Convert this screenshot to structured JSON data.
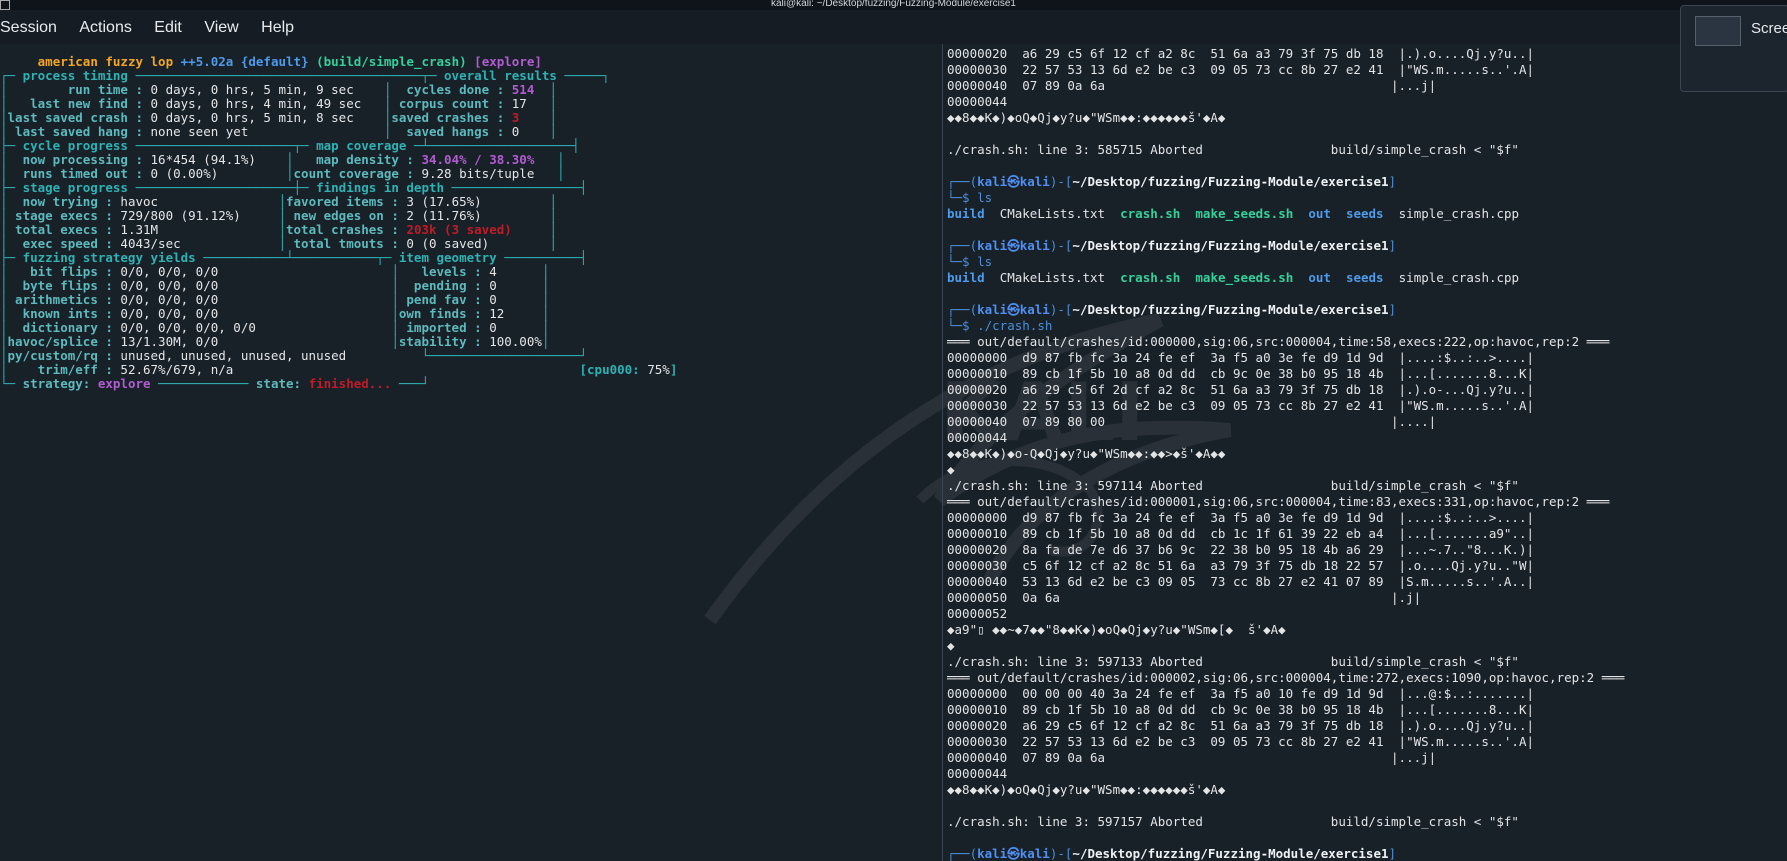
{
  "window": {
    "title": "kali@kali: ~/Desktop/fuzzing/Fuzzing-Module/exercise1"
  },
  "menu": [
    "Session",
    "Actions",
    "Edit",
    "View",
    "Help"
  ],
  "notification": {
    "label": "Scree"
  },
  "afl": {
    "banner": {
      "name": "american fuzzy lop ",
      "version": "++5.02a",
      "instance": " {default} ",
      "target": "(build/simple_crash) ",
      "mode": "[explore]"
    },
    "sections": {
      "process_timing": "process timing",
      "overall_results": "overall results",
      "cycle_progress": "cycle progress",
      "map_coverage": "map coverage",
      "stage_progress": "stage progress",
      "findings": "findings in depth",
      "strategy_yields": "fuzzing strategy yields",
      "item_geometry": "item geometry"
    },
    "process_timing": [
      {
        "label": "        run time :",
        "value": " 0 days, 0 hrs, 5 min, 9 sec"
      },
      {
        "label": "   last new find :",
        "value": " 0 days, 0 hrs, 4 min, 49 sec"
      },
      {
        "label": "last saved crash :",
        "value": " 0 days, 0 hrs, 5 min, 8 sec"
      },
      {
        "label": " last saved hang :",
        "value": " none seen yet"
      }
    ],
    "overall_results": [
      {
        "label": "  cycles done :",
        "value": " 514",
        "cls": "c-mag"
      },
      {
        "label": " corpus count :",
        "value": " 17",
        "cls": "c-val"
      },
      {
        "label": "saved crashes :",
        "value": " 3",
        "cls": "c-warn"
      },
      {
        "label": "  saved hangs :",
        "value": " 0",
        "cls": "c-val"
      }
    ],
    "cycle_progress": [
      {
        "label": "  now processing :",
        "value": " 16*454 (94.1%)"
      },
      {
        "label": "  runs timed out :",
        "value": " 0 (0.00%)"
      }
    ],
    "map_coverage": [
      {
        "label": "   map density :",
        "value": " 34.04% / 38.30%",
        "cls": "c-mag"
      },
      {
        "label": "count coverage :",
        "value": " 9.28 bits/tuple",
        "cls": "c-val"
      }
    ],
    "stage_progress": [
      {
        "label": "  now trying :",
        "value": " havoc"
      },
      {
        "label": " stage execs :",
        "value": " 729/800 (91.12%)"
      },
      {
        "label": " total execs :",
        "value": " 1.31M"
      },
      {
        "label": "  exec speed :",
        "value": " 4043/sec"
      }
    ],
    "findings": [
      {
        "label": "favored items :",
        "value": " 3 (17.65%)",
        "cls": "c-val"
      },
      {
        "label": " new edges on :",
        "value": " 2 (11.76%)",
        "cls": "c-val"
      },
      {
        "label": "total crashes :",
        "value": " 203k (3 saved)",
        "cls": "c-warn"
      },
      {
        "label": " total tmouts :",
        "value": " 0 (0 saved)",
        "cls": "c-val"
      }
    ],
    "yields": [
      {
        "label": "   bit flips :",
        "value": " 0/0, 0/0, 0/0"
      },
      {
        "label": "  byte flips :",
        "value": " 0/0, 0/0, 0/0"
      },
      {
        "label": " arithmetics :",
        "value": " 0/0, 0/0, 0/0"
      },
      {
        "label": "  known ints :",
        "value": " 0/0, 0/0, 0/0"
      },
      {
        "label": "  dictionary :",
        "value": " 0/0, 0/0, 0/0, 0/0"
      },
      {
        "label": "havoc/splice :",
        "value": " 13/1.30M, 0/0"
      },
      {
        "label": "py/custom/rq :",
        "value": " unused, unused, unused, unused"
      },
      {
        "label": "    trim/eff :",
        "value": " 52.67%/679, n/a"
      }
    ],
    "geometry": [
      {
        "label": "   levels :",
        "value": " 4"
      },
      {
        "label": "  pending :",
        "value": " 0"
      },
      {
        "label": " pend fav :",
        "value": " 0"
      },
      {
        "label": "own finds :",
        "value": " 12"
      },
      {
        "label": " imported :",
        "value": " 0"
      },
      {
        "label": "stability :",
        "value": " 100.00%"
      }
    ],
    "cpu": {
      "label": "[cpu000: ",
      "value": "75%",
      "close": "]"
    },
    "strategy": {
      "label": "strategy: ",
      "value": "explore"
    },
    "state": {
      "label": "state: ",
      "value": "finished..."
    }
  },
  "terminal": {
    "prompt": {
      "user": "kali",
      "at": "㉿",
      "host": "kali",
      "path": "~/Desktop/fuzzing/Fuzzing-Module/exercise1"
    },
    "lines": [
      {
        "t": "text",
        "v": "00000020  a6 29 c5 6f 12 cf a2 8c  51 6a a3 79 3f 75 db 18  |.).o....Qj.y?u..|"
      },
      {
        "t": "text",
        "v": "00000030  22 57 53 13 6d e2 be c3  09 05 73 cc 8b 27 e2 41  |\"WS.m.....s..'.A|"
      },
      {
        "t": "text",
        "v": "00000040  07 89 0a 6a                                      |...j|"
      },
      {
        "t": "text",
        "v": "00000044"
      },
      {
        "t": "text",
        "v": "◆◆8◆◆K◆)◆oQ◆Qj◆y?u◆\"WSm◆◆:◆◆◆◆◆◆š'◆A◆"
      },
      {
        "t": "text",
        "v": ""
      },
      {
        "t": "text",
        "v": "./crash.sh: line 3: 585715 Aborted                 build/simple_crash < \"$f\""
      },
      {
        "t": "text",
        "v": ""
      },
      {
        "t": "prompt"
      },
      {
        "t": "cmd",
        "v": "ls"
      },
      {
        "t": "ls"
      },
      {
        "t": "text",
        "v": ""
      },
      {
        "t": "prompt"
      },
      {
        "t": "cmd",
        "v": "ls"
      },
      {
        "t": "ls"
      },
      {
        "t": "text",
        "v": ""
      },
      {
        "t": "prompt"
      },
      {
        "t": "cmd",
        "v": "./crash.sh"
      },
      {
        "t": "text",
        "v": "═══ out/default/crashes/id:000000,sig:06,src:000004,time:58,execs:222,op:havoc,rep:2 ═══"
      },
      {
        "t": "text",
        "v": "00000000  d9 87 fb fc 3a 24 fe ef  3a f5 a0 3e fe d9 1d 9d  |....:$..:..>....|"
      },
      {
        "t": "text",
        "v": "00000010  89 cb 1f 5b 10 a8 0d dd  cb 9c 0e 38 b0 95 18 4b  |...[.......8...K|"
      },
      {
        "t": "text",
        "v": "00000020  a6 29 c5 6f 2d cf a2 8c  51 6a a3 79 3f 75 db 18  |.).o-...Qj.y?u..|"
      },
      {
        "t": "text",
        "v": "00000030  22 57 53 13 6d e2 be c3  09 05 73 cc 8b 27 e2 41  |\"WS.m.....s..'.A|"
      },
      {
        "t": "text",
        "v": "00000040  07 89 80 00                                      |....|"
      },
      {
        "t": "text",
        "v": "00000044"
      },
      {
        "t": "text",
        "v": "◆◆8◆◆K◆)◆o-Q◆Qj◆y?u◆\"WSm◆◆:◆◆>◆š'◆A◆◆"
      },
      {
        "t": "text",
        "v": "◆"
      },
      {
        "t": "text",
        "v": "./crash.sh: line 3: 597114 Aborted                 build/simple_crash < \"$f\""
      },
      {
        "t": "text",
        "v": "═══ out/default/crashes/id:000001,sig:06,src:000004,time:83,execs:331,op:havoc,rep:2 ═══"
      },
      {
        "t": "text",
        "v": "00000000  d9 87 fb fc 3a 24 fe ef  3a f5 a0 3e fe d9 1d 9d  |....:$..:..>....|"
      },
      {
        "t": "text",
        "v": "00000010  89 cb 1f 5b 10 a8 0d dd  cb 1c 1f 61 39 22 eb a4  |...[.......a9\"..|"
      },
      {
        "t": "text",
        "v": "00000020  8a fa de 7e d6 37 b6 9c  22 38 b0 95 18 4b a6 29  |...~.7..\"8...K.)|"
      },
      {
        "t": "text",
        "v": "00000030  c5 6f 12 cf a2 8c 51 6a  a3 79 3f 75 db 18 22 57  |.o....Qj.y?u..\"W|"
      },
      {
        "t": "text",
        "v": "00000040  53 13 6d e2 be c3 09 05  73 cc 8b 27 e2 41 07 89  |S.m.....s..'.A..|"
      },
      {
        "t": "text",
        "v": "00000050  0a 6a                                            |.j|"
      },
      {
        "t": "text",
        "v": "00000052"
      },
      {
        "t": "text",
        "v": "◆a9\"▯ ◆◆~◆7◆◆\"8◆◆K◆)◆oQ◆Qj◆y?u◆\"WSm◆[◆  š'◆A◆"
      },
      {
        "t": "text",
        "v": "◆"
      },
      {
        "t": "text",
        "v": "./crash.sh: line 3: 597133 Aborted                 build/simple_crash < \"$f\""
      },
      {
        "t": "text",
        "v": "═══ out/default/crashes/id:000002,sig:06,src:000004,time:272,execs:1090,op:havoc,rep:2 ═══"
      },
      {
        "t": "text",
        "v": "00000000  00 00 00 40 3a 24 fe ef  3a f5 a0 10 fe d9 1d 9d  |...@:$..:.......|"
      },
      {
        "t": "text",
        "v": "00000010  89 cb 1f 5b 10 a8 0d dd  cb 9c 0e 38 b0 95 18 4b  |...[.......8...K|"
      },
      {
        "t": "text",
        "v": "00000020  a6 29 c5 6f 12 cf a2 8c  51 6a a3 79 3f 75 db 18  |.).o....Qj.y?u..|"
      },
      {
        "t": "text",
        "v": "00000030  22 57 53 13 6d e2 be c3  09 05 73 cc 8b 27 e2 41  |\"WS.m.....s..'.A|"
      },
      {
        "t": "text",
        "v": "00000040  07 89 0a 6a                                      |...j|"
      },
      {
        "t": "text",
        "v": "00000044"
      },
      {
        "t": "text",
        "v": "◆◆8◆◆K◆)◆oQ◆Qj◆y?u◆\"WSm◆◆:◆◆◆◆◆◆š'◆A◆"
      },
      {
        "t": "text",
        "v": ""
      },
      {
        "t": "text",
        "v": "./crash.sh: line 3: 597157 Aborted                 build/simple_crash < \"$f\""
      },
      {
        "t": "text",
        "v": ""
      },
      {
        "t": "prompt"
      }
    ],
    "ls_entries": [
      {
        "name": "build",
        "kind": "dir"
      },
      {
        "name": "CMakeLists.txt",
        "kind": "file"
      },
      {
        "name": "crash.sh",
        "kind": "exe"
      },
      {
        "name": "make_seeds.sh",
        "kind": "exe"
      },
      {
        "name": "out",
        "kind": "dir"
      },
      {
        "name": "seeds",
        "kind": "dir"
      },
      {
        "name": "simple_crash.cpp",
        "kind": "file"
      }
    ]
  },
  "colors": {
    "background": "#182028",
    "afl_frame": "#2fb2b4",
    "prompt_frame": "#4d8fd6",
    "error": "#c01c28"
  },
  "icons": [
    "terminal-window-icon",
    "kali-dragon-watermark",
    "screenshot-thumbnail"
  ]
}
